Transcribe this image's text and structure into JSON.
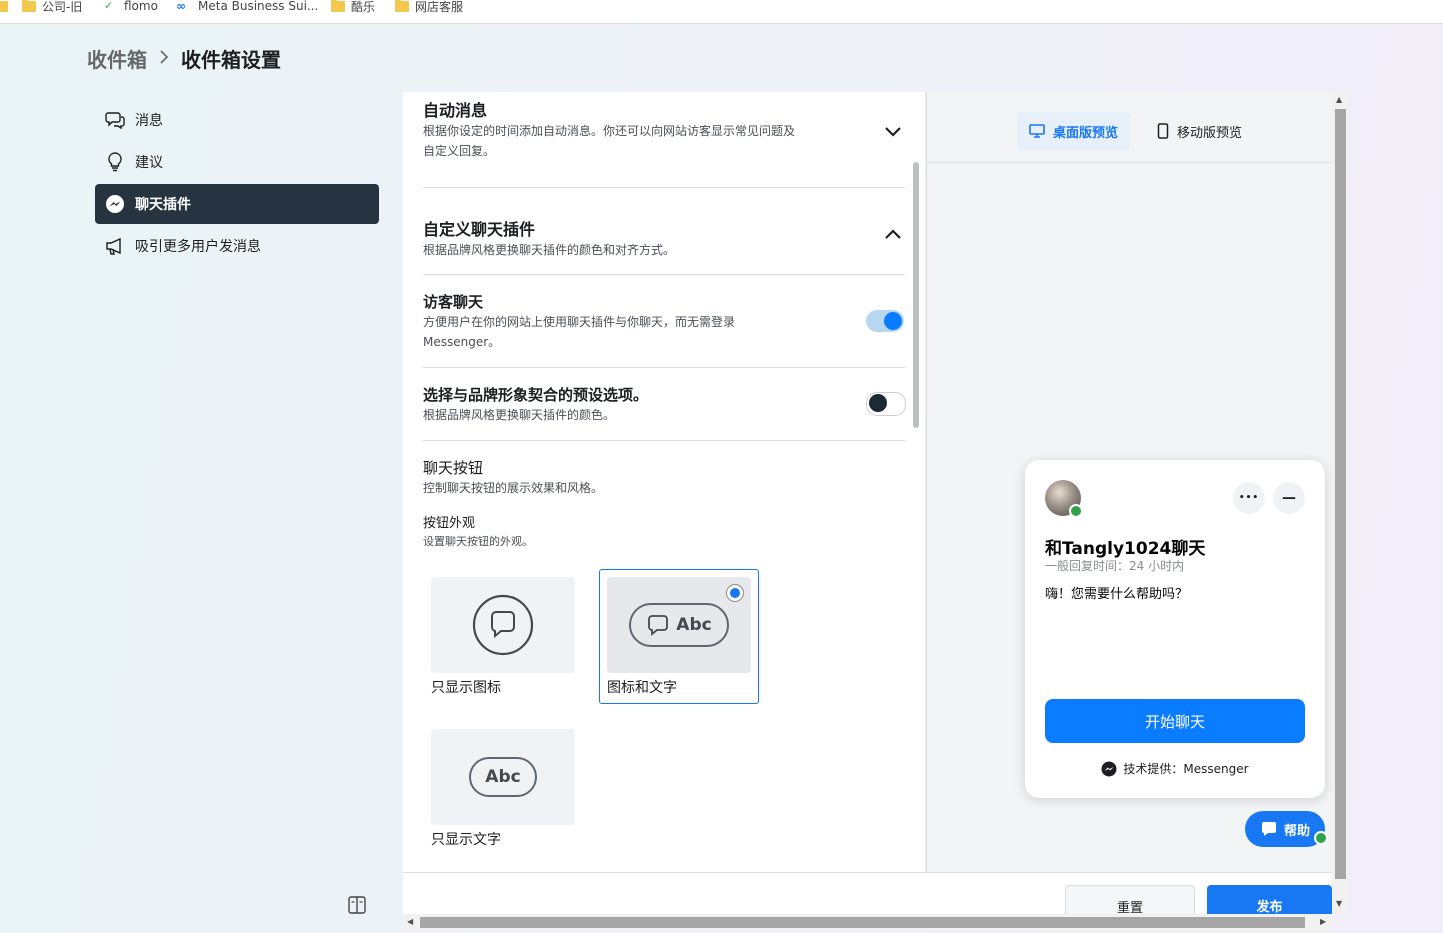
{
  "bookmarks": [
    {
      "label": "公司-旧"
    },
    {
      "label": "flomo"
    },
    {
      "label": "Meta Business Sui..."
    },
    {
      "label": "酷乐"
    },
    {
      "label": "网店客服"
    }
  ],
  "breadcrumb": {
    "root": "收件箱",
    "current": "收件箱设置"
  },
  "sidebar": {
    "items": [
      {
        "label": "消息",
        "icon": "chat-bubbles-icon"
      },
      {
        "label": "建议",
        "icon": "lightbulb-icon"
      },
      {
        "label": "聊天插件",
        "icon": "messenger-icon",
        "active": true
      },
      {
        "label": "吸引更多用户发消息",
        "icon": "megaphone-icon"
      }
    ]
  },
  "settings": {
    "auto_message": {
      "title": "自动消息",
      "desc_line1": "根据你设定的时间添加自动消息。你还可以向网站访客显示常见问题及",
      "desc_line2": "自定义回复。"
    },
    "customize": {
      "title": "自定义聊天插件",
      "desc": "根据品牌风格更换聊天插件的颜色和对齐方式。"
    },
    "guest_chat": {
      "title": "访客聊天",
      "desc_line1": "方便用户在你的网站上使用聊天插件与你聊天，而无需登录",
      "desc_line2": "Messenger。",
      "enabled": true
    },
    "brand_preset": {
      "title": "选择与品牌形象契合的预设选项。",
      "desc": "根据品牌风格更换聊天插件的颜色。",
      "enabled": false
    },
    "chat_button": {
      "title": "聊天按钮",
      "desc": "控制聊天按钮的展示效果和风格。",
      "appearance_title": "按钮外观",
      "appearance_desc": "设置聊天按钮的外观。",
      "options": [
        {
          "label": "只显示图标",
          "selected": false
        },
        {
          "label": "图标和文字",
          "selected": true,
          "pill_text": "Abc"
        },
        {
          "label": "只显示文字",
          "selected": false,
          "pill_text": "Abc"
        }
      ]
    }
  },
  "preview": {
    "tabs": [
      {
        "label": "桌面版预览",
        "active": true
      },
      {
        "label": "移动版预览",
        "active": false
      }
    ],
    "chat": {
      "title": "和Tangly1024聊天",
      "reply_time": "一般回复时间：24 小时内",
      "greeting": "嗨！您需要什么帮助吗？",
      "start_button": "开始聊天",
      "powered_by": "技术提供：Messenger",
      "more_symbol": "•••",
      "minimize_symbol": "—"
    },
    "help_button": "帮助"
  },
  "footer": {
    "reset": "重置",
    "publish": "发布"
  },
  "colors": {
    "accent": "#1877f2",
    "active_nav": "#253440",
    "start_button": "#0a7cff",
    "online": "#31a24c"
  }
}
